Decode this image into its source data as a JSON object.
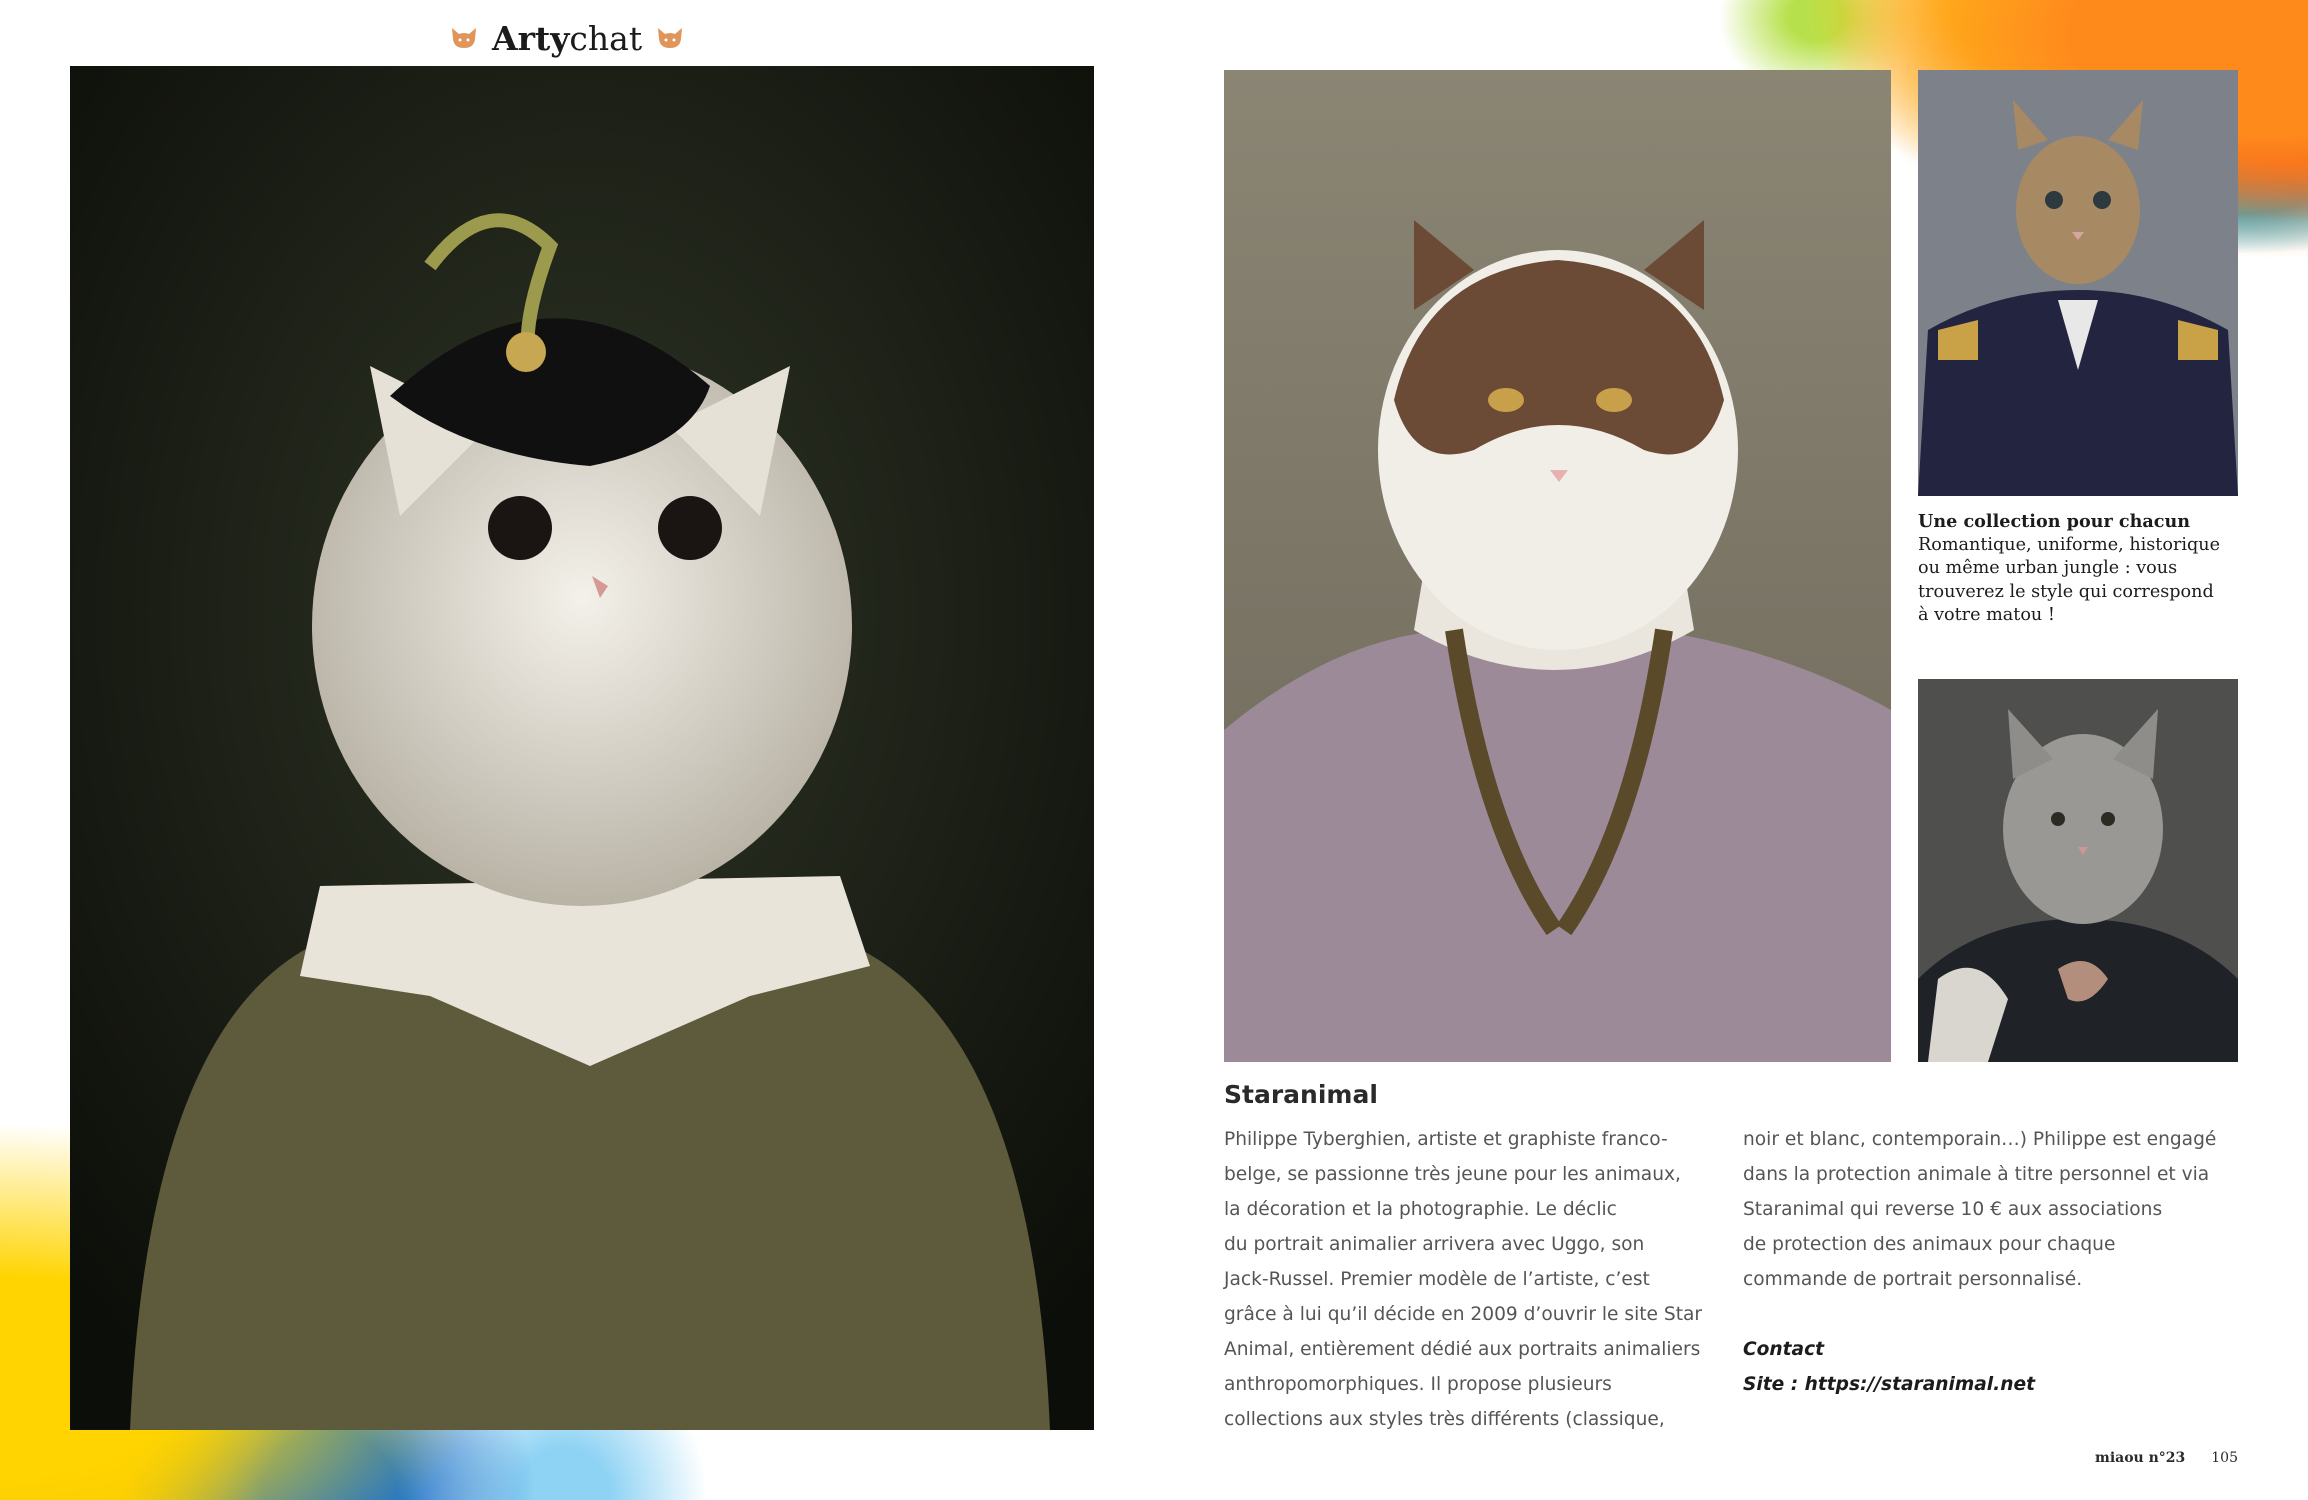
{
  "header": {
    "brand_bold": "Arty",
    "brand_rest": "chat",
    "left_icon": "cat-head-icon",
    "right_icon": "cat-head-icon"
  },
  "colors": {
    "icon": "#e0965a",
    "text": "#555555",
    "heading": "#2a2a2a"
  },
  "photos": {
    "main": "white-cat-portrait-feathered-hat",
    "lavender": "calico-cat-portrait-lavender-doublet",
    "uniform": "tabby-cat-portrait-military-uniform",
    "grey": "grey-cat-portrait-dark-cloak"
  },
  "caption": {
    "title": "Une collection pour chacun",
    "lines": [
      "Romantique, uniforme, historique",
      "ou même urban jungle : vous",
      "trouverez le style qui correspond",
      "à votre matou !"
    ]
  },
  "article": {
    "title": "Staranimal",
    "col1": [
      "Philippe Tyberghien, artiste et graphiste franco-",
      "belge, se passionne très jeune pour les animaux,",
      "la décoration et la photographie. Le déclic",
      "du portrait animalier arrivera avec Uggo, son",
      "Jack-Russel. Premier modèle de l’artiste, c’est",
      "grâce à lui qu’il décide en 2009 d’ouvrir le site Star",
      "Animal, entièrement dédié aux portraits animaliers",
      "anthropomorphiques. Il propose plusieurs",
      "collections aux styles très différents (classique,"
    ],
    "col2": [
      "noir et blanc, contemporain…) Philippe est engagé",
      "dans la protection animale à titre personnel et via",
      "Staranimal qui reverse 10 € aux associations",
      "de protection des animaux pour chaque",
      "commande de portrait personnalisé."
    ],
    "contact_label": "Contact",
    "site_line": "Site : https://staranimal.net"
  },
  "footer": {
    "magazine": "miaou n°23",
    "page": "105"
  }
}
